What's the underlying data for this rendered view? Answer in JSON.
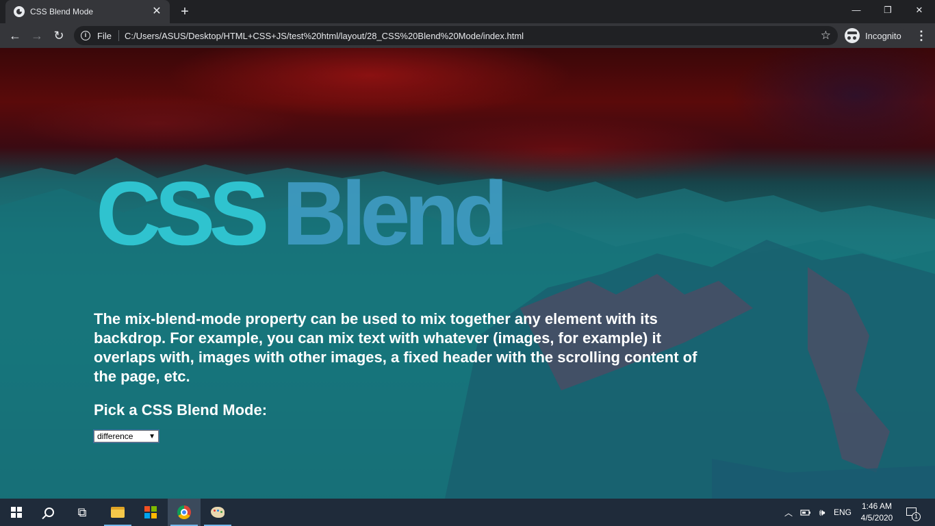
{
  "browser": {
    "tab_title": "CSS Blend Mode",
    "tab_close": "✕",
    "new_tab": "+",
    "window": {
      "minimize": "—",
      "restore": "❐",
      "close": "✕"
    },
    "nav": {
      "back": "←",
      "forward": "→",
      "reload": "↻"
    },
    "omnibox": {
      "info": "i",
      "scheme": "File",
      "url": "C:/Users/ASUS/Desktop/HTML+CSS+JS/test%20html/layout/28_CSS%20Blend%20Mode/index.html",
      "bookmark": "☆"
    },
    "profile_label": "Incognito",
    "menu": "⋮"
  },
  "page": {
    "heading_part1": "CSS",
    "heading_part2": "Blend",
    "description": "The mix-blend-mode property can be used to mix together any element with its backdrop. For example, you can mix text with whatever (images, for example) it overlaps with, images with other images, a fixed header with the scrolling content of the page, etc.",
    "pick_label": "Pick a CSS Blend Mode:",
    "select_value": "difference",
    "select_arrow": "▼"
  },
  "taskbar": {
    "task_view": "⧉",
    "tray_chevron": "︿",
    "tray_volume": "🕪",
    "language": "ENG",
    "time": "1:46 AM",
    "date": "4/5/2020",
    "notification_count": "1"
  }
}
